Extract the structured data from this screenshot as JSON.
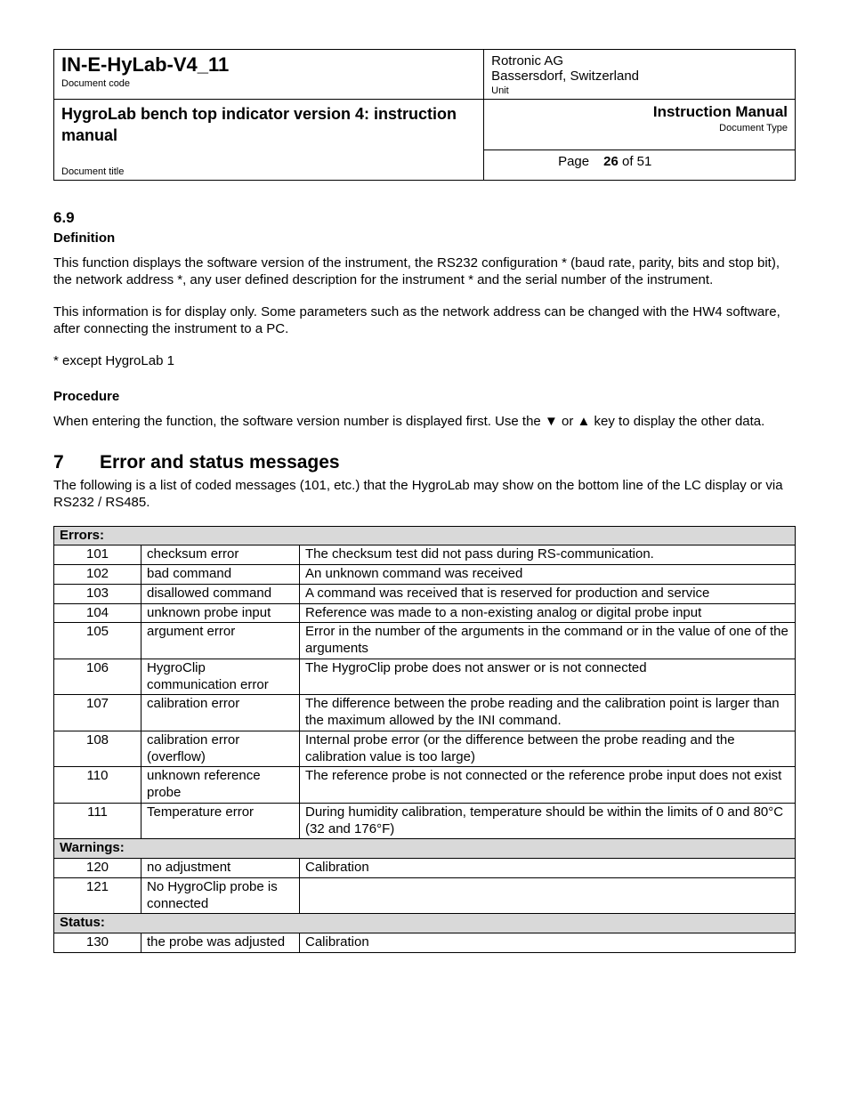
{
  "header": {
    "doc_code": "IN-E-HyLab-V4_11",
    "doc_code_label": "Document code",
    "company_line1": "Rotronic AG",
    "company_line2": "Bassersdorf, Switzerland",
    "unit_label": "Unit",
    "doc_title": "HygroLab bench top indicator version 4: instruction manual",
    "doc_title_label": "Document title",
    "doctype_value": "Instruction Manual",
    "doctype_label": "Document Type",
    "page_word": "Page",
    "page_current": "26",
    "page_of": "of",
    "page_total": "51"
  },
  "section69": {
    "number": "6.9",
    "h_def": "Definition",
    "p1": "This function displays the software version of the instrument, the RS232 configuration * (baud rate, parity, bits and stop bit), the network address *, any user defined description for the instrument * and the serial number of the instrument.",
    "p2": "This information is for display only. Some parameters such as the network address can be changed with the HW4 software, after connecting the instrument to a PC.",
    "note": " * except HygroLab 1",
    "h_proc": "Procedure",
    "p3a": "When entering the function, the software version number is displayed first. Use the ",
    "icon_down": "▼",
    "p3b": " or ",
    "icon_up": "▲",
    "p3c": " key to display the other data."
  },
  "chapter7": {
    "num": "7",
    "title": "Error and status messages",
    "intro": "The following is a list of coded messages (101, etc.) that the HygroLab may show on the bottom line of the LC display or via RS232 / RS485."
  },
  "table": {
    "sections": [
      {
        "label": "Errors:",
        "rows": [
          {
            "code": "101",
            "name": "checksum error",
            "desc": "The checksum test did not pass during RS-communication."
          },
          {
            "code": "102",
            "name": "bad command",
            "desc": "An unknown command was received"
          },
          {
            "code": "103",
            "name": "disallowed command",
            "desc": "A command was received that is reserved for production and service"
          },
          {
            "code": "104",
            "name": "unknown probe input",
            "desc": "Reference was made to a non-existing analog or digital probe input"
          },
          {
            "code": "105",
            "name": "argument error",
            "desc": "Error in the number of the arguments in the command or in the value of one of the arguments"
          },
          {
            "code": "106",
            "name": "HygroClip communication error",
            "desc": "The HygroClip probe does not answer or is not connected"
          },
          {
            "code": "107",
            "name": "calibration error",
            "desc": "The difference between the probe reading and the calibration point is larger than the maximum allowed by the INI command."
          },
          {
            "code": "108",
            "name": "calibration error (overflow)",
            "desc": "Internal probe error (or the difference between the probe reading and the calibration value is too large)"
          },
          {
            "code": "110",
            "name": "unknown reference probe",
            "desc": "The reference probe is not connected or the reference probe input does not exist"
          },
          {
            "code": "111",
            "name": "Temperature error",
            "desc": "During humidity calibration, temperature should be within the limits of 0 and 80°C (32 and 176°F)"
          }
        ]
      },
      {
        "label": "Warnings:",
        "rows": [
          {
            "code": "120",
            "name": "no adjustment",
            "desc": "Calibration"
          },
          {
            "code": "121",
            "name": "No HygroClip probe is connected",
            "desc": ""
          }
        ]
      },
      {
        "label": "Status:",
        "rows": [
          {
            "code": "130",
            "name": "the probe was adjusted",
            "desc": "Calibration"
          }
        ]
      }
    ]
  }
}
